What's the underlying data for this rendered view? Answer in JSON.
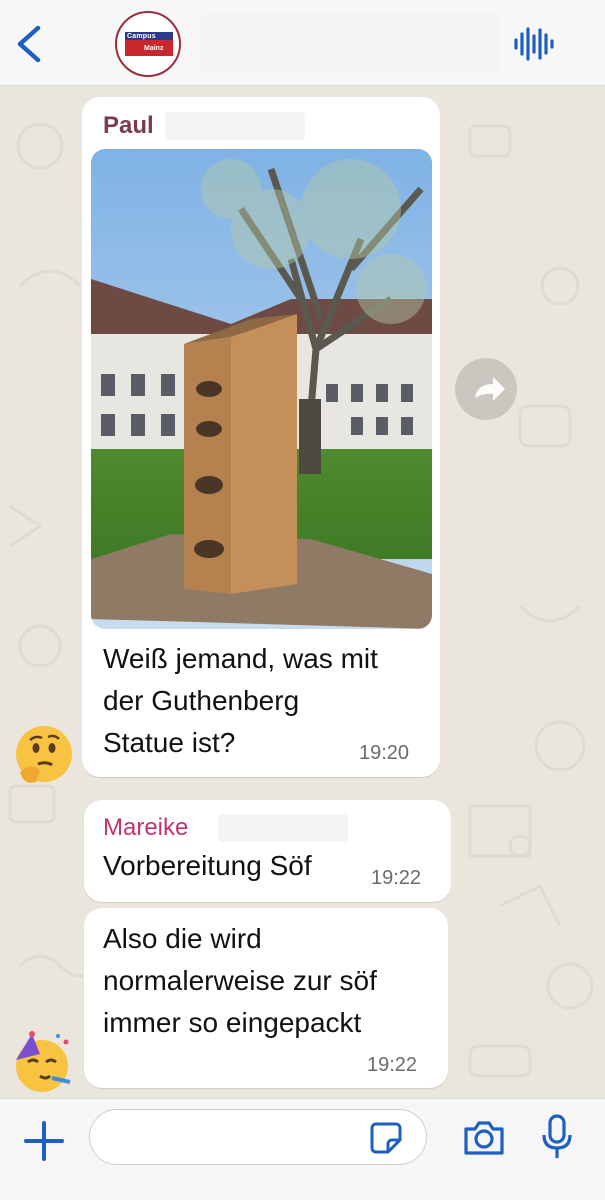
{
  "header": {
    "back_icon": "chevron-left-icon",
    "avatar_text_top": "Campus",
    "avatar_text_bottom": "Mainz",
    "audio_icon": "waveform-icon"
  },
  "colors": {
    "accent": "#1f5fbf",
    "paul": "#7a3b4e",
    "mareike": "#c2346f",
    "wallpaper": "#ebe6dd"
  },
  "messages": [
    {
      "sender": "Paul",
      "image": "photo of a wooden-boxed statue in a courtyard",
      "text_lines": [
        "Weiß jemand, was mit",
        "der Guthenberg",
        "Statue ist?"
      ],
      "time": "19:20",
      "reaction_emoji": "🤔"
    },
    {
      "sender": "Mareike",
      "text_lines": [
        "Vorbereitung Söf"
      ],
      "time": "19:22"
    },
    {
      "sender": "",
      "text_lines": [
        "Also die wird",
        "normalerweise zur söf",
        "immer so eingepackt"
      ],
      "time": "19:22",
      "reaction_emoji": "🥳"
    }
  ],
  "composer": {
    "plus_icon": "plus-icon",
    "input_placeholder": "",
    "sticker_icon": "sticker-icon",
    "camera_icon": "camera-icon",
    "mic_icon": "microphone-icon"
  }
}
